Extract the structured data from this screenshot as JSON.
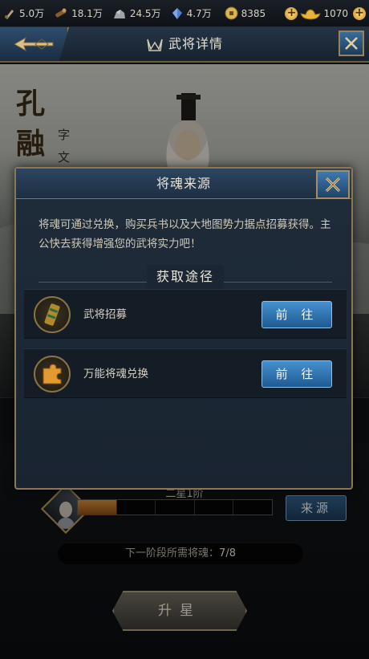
{
  "resources": [
    {
      "icon": "troops-icon",
      "value": "5.0万"
    },
    {
      "icon": "wood-icon",
      "value": "18.1万"
    },
    {
      "icon": "stone-icon",
      "value": "24.5万"
    },
    {
      "icon": "crystal-icon",
      "value": "4.7万"
    },
    {
      "icon": "coin-icon",
      "value": "8385"
    }
  ],
  "ingot": {
    "icon": "gold-ingot-icon",
    "value": "1070"
  },
  "header": {
    "title": "武将详情"
  },
  "general": {
    "name_chars": [
      "孔",
      "融"
    ],
    "courtesy_chars": [
      "字",
      "文"
    ]
  },
  "dialog": {
    "title": "将魂来源",
    "description": "将魂可通过兑换，购买兵书以及大地图势力据点招募获得。主公快去获得增强您的武将实力吧！",
    "ways_title": "获取途径",
    "routes": [
      {
        "icon": "scroll-icon",
        "label": "武将招募",
        "button": "前 往"
      },
      {
        "icon": "puzzle-icon",
        "label": "万能将魂兑换",
        "button": "前 往"
      }
    ]
  },
  "panel": {
    "star_label": "二星1阶",
    "progress": {
      "current": 7,
      "total": 8,
      "segments": 5,
      "filled_fraction": 0.2
    },
    "source_button": "来源",
    "need_prefix": "下一阶段所需将魂：",
    "need_value": "7/8",
    "starup_button": "升星"
  },
  "colors": {
    "accent_gold": "#8d7750",
    "button_blue": "#1f5a92",
    "progress_orange": "#d28c3a"
  }
}
